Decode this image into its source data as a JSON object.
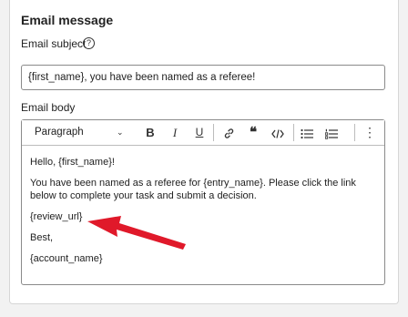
{
  "section": {
    "title": "Email message"
  },
  "subject": {
    "label": "Email subject",
    "help_icon_glyph": "?",
    "value": "{first_name}, you have been named as a referee!"
  },
  "body": {
    "label": "Email body",
    "toolbar": {
      "block_format": "Paragraph",
      "dropdown_glyph": "⌄",
      "bold": "B",
      "italic": "I",
      "underline": "U",
      "quote": "❝",
      "more": "⋮"
    },
    "paragraphs": [
      "Hello, {first_name}!",
      "You have been named as a referee for {entry_name}. Please click the link below to complete your task and submit a decision.",
      "{review_url}",
      "Best,",
      "{account_name}"
    ]
  },
  "annotation": {
    "arrow_color": "#e0192a"
  },
  "colors": {
    "panel_bg": "#ffffff",
    "page_bg": "#f2f2f2",
    "border": "#8a8a8a"
  }
}
